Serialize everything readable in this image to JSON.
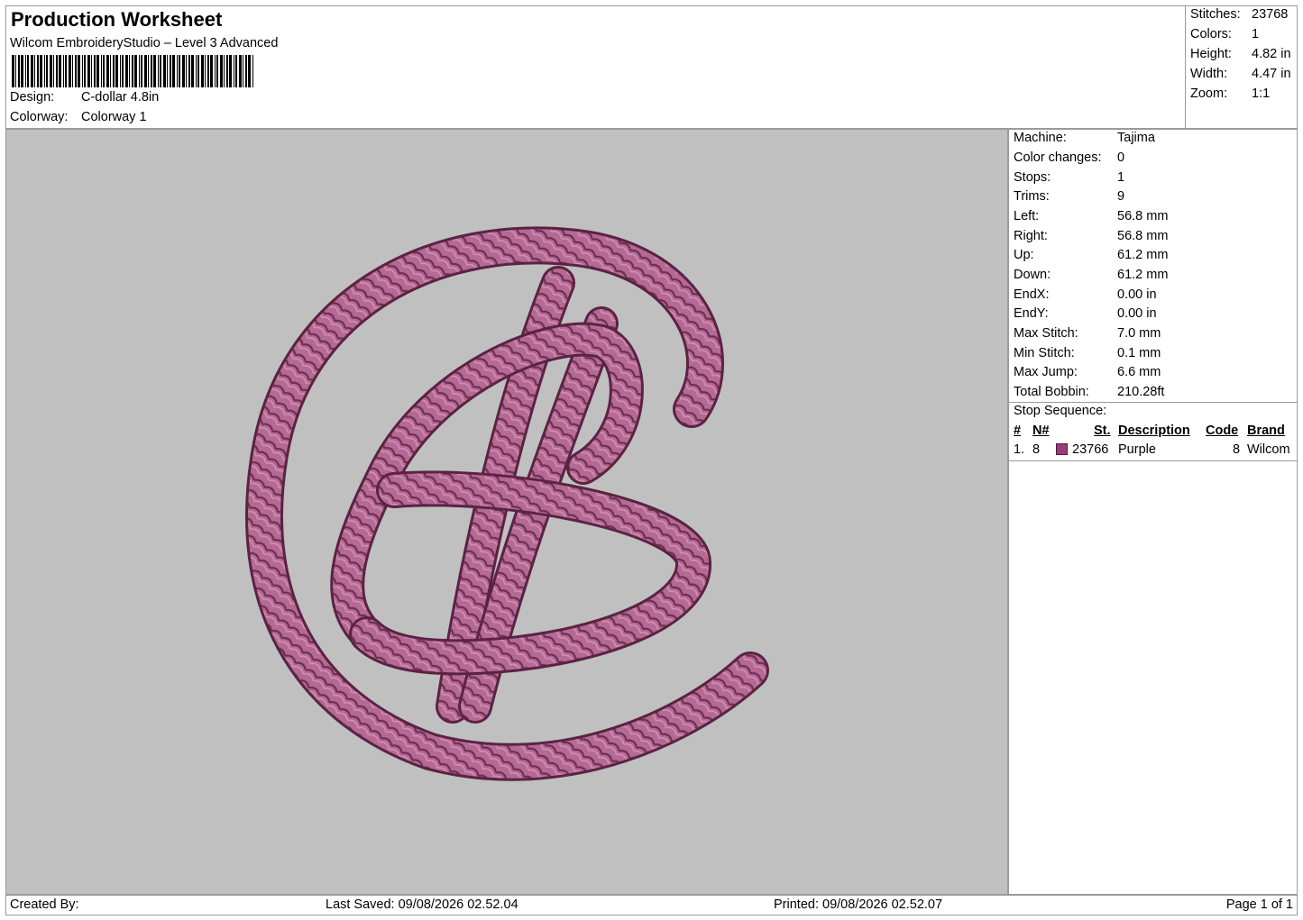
{
  "header": {
    "title": "Production Worksheet",
    "subtitle": "Wilcom EmbroideryStudio – Level 3 Advanced",
    "design_label": "Design:",
    "design_value": "C-dollar 4.8in",
    "colorway_label": "Colorway:",
    "colorway_value": "Colorway 1"
  },
  "stats": [
    {
      "label": "Stitches:",
      "value": "23768"
    },
    {
      "label": "Colors:",
      "value": "1"
    },
    {
      "label": "Height:",
      "value": "4.82 in"
    },
    {
      "label": "Width:",
      "value": "4.47 in"
    },
    {
      "label": "Zoom:",
      "value": "1:1"
    }
  ],
  "machine_info": [
    {
      "label": "Machine:",
      "value": "Tajima"
    },
    {
      "label": "Color changes:",
      "value": "0"
    },
    {
      "label": "Stops:",
      "value": "1"
    },
    {
      "label": "Trims:",
      "value": "9"
    },
    {
      "label": "Left:",
      "value": "56.8 mm"
    },
    {
      "label": "Right:",
      "value": "56.8 mm"
    },
    {
      "label": "Up:",
      "value": "61.2 mm"
    },
    {
      "label": "Down:",
      "value": "61.2 mm"
    },
    {
      "label": "EndX:",
      "value": "0.00 in"
    },
    {
      "label": "EndY:",
      "value": "0.00 in"
    },
    {
      "label": "Max Stitch:",
      "value": "7.0 mm"
    },
    {
      "label": "Min Stitch:",
      "value": "0.1 mm"
    },
    {
      "label": "Max Jump:",
      "value": "6.6 mm"
    },
    {
      "label": "Total Bobbin:",
      "value": "210.28ft"
    }
  ],
  "stop_sequence": {
    "title": "Stop Sequence:",
    "headers": {
      "num": "#",
      "n": "N#",
      "st": "St.",
      "description": "Description",
      "code": "Code",
      "brand": "Brand"
    },
    "rows": [
      {
        "num": "1.",
        "n": "8",
        "st": "23766",
        "description": "Purple",
        "code": "8",
        "brand": "Wilcom",
        "color": "#9c3b77"
      }
    ]
  },
  "colors": {
    "canvas_bg": "#c0c0c0",
    "thread": "#b46a93",
    "thread_dark": "#6e2d52",
    "thread_light": "#d48db3"
  },
  "footer": {
    "created_by": "Created By:",
    "last_saved": "Last Saved: 09/08/2026 02.52.04",
    "printed": "Printed: 09/08/2026 02.52.07",
    "page": "Page 1 of 1"
  }
}
